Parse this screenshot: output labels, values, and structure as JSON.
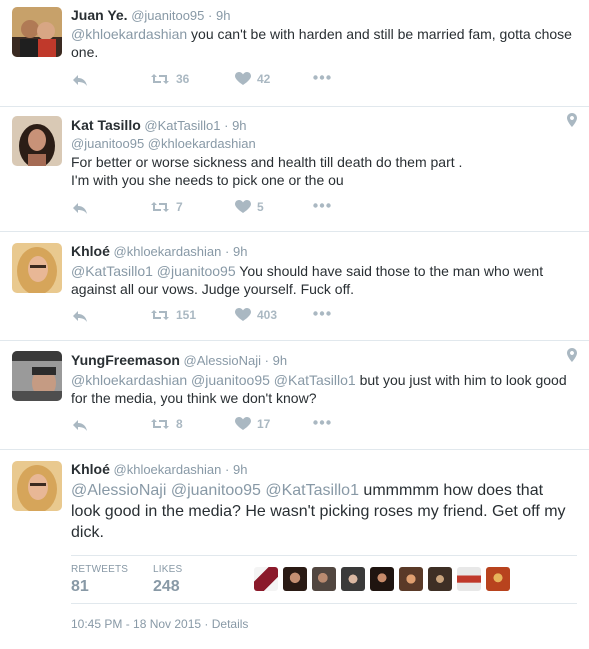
{
  "tweets": [
    {
      "fullname": "Juan Ye.",
      "handle": "@juanitoo95",
      "dot": "·",
      "time": "9h",
      "mentions": "@khloekardashian",
      "text": " you can't be with harden and still be married fam, gotta chose one.",
      "retweets": "36",
      "likes": "42"
    },
    {
      "fullname": "Kat Tasillo",
      "handle": "@KatTasillo1",
      "dot": "·",
      "time": "9h",
      "replying": "@juanitoo95 @khloekardashian",
      "text": "For better or worse sickness and health till death do them part .\nI'm with you she needs to pick one or the ou",
      "retweets": "7",
      "likes": "5"
    },
    {
      "fullname": "Khloé",
      "handle": "@khloekardashian",
      "dot": "·",
      "time": "9h",
      "mentions": "@KatTasillo1 @juanitoo95",
      "text": " You should have said those to the man who went against all our vows. Judge yourself. Fuck off.",
      "retweets": "151",
      "likes": "403"
    },
    {
      "fullname": "YungFreemason",
      "handle": "@AlessioNaji",
      "dot": "·",
      "time": "9h",
      "mentions": "@khloekardashian @juanitoo95 @KatTasillo1",
      "text": " but you just with him to look good for the media, you think we don't know?",
      "retweets": "8",
      "likes": "17"
    },
    {
      "fullname": "Khloé",
      "handle": "@khloekardashian",
      "dot": "·",
      "time": "9h",
      "mentions": "@AlessioNaji @juanitoo95 @KatTasillo1",
      "text": " ummmmm how does that look good in the media? He wasn't picking roses my friend. Get off my dick."
    }
  ],
  "stats": {
    "retweets_label": "RETWEETS",
    "retweets_value": "81",
    "likes_label": "LIKES",
    "likes_value": "248"
  },
  "timestamp": "10:45 PM - 18 Nov 2015 · Details",
  "icons": {
    "reply": "reply-arrow-icon",
    "retweet": "retweet-icon",
    "like": "heart-icon",
    "more": "more-dots-icon",
    "location": "location-pin-icon"
  },
  "colors": {
    "mention": "#8899a6",
    "icon": "#aab8c2",
    "border": "#e1e8ed",
    "text": "#292f33"
  }
}
